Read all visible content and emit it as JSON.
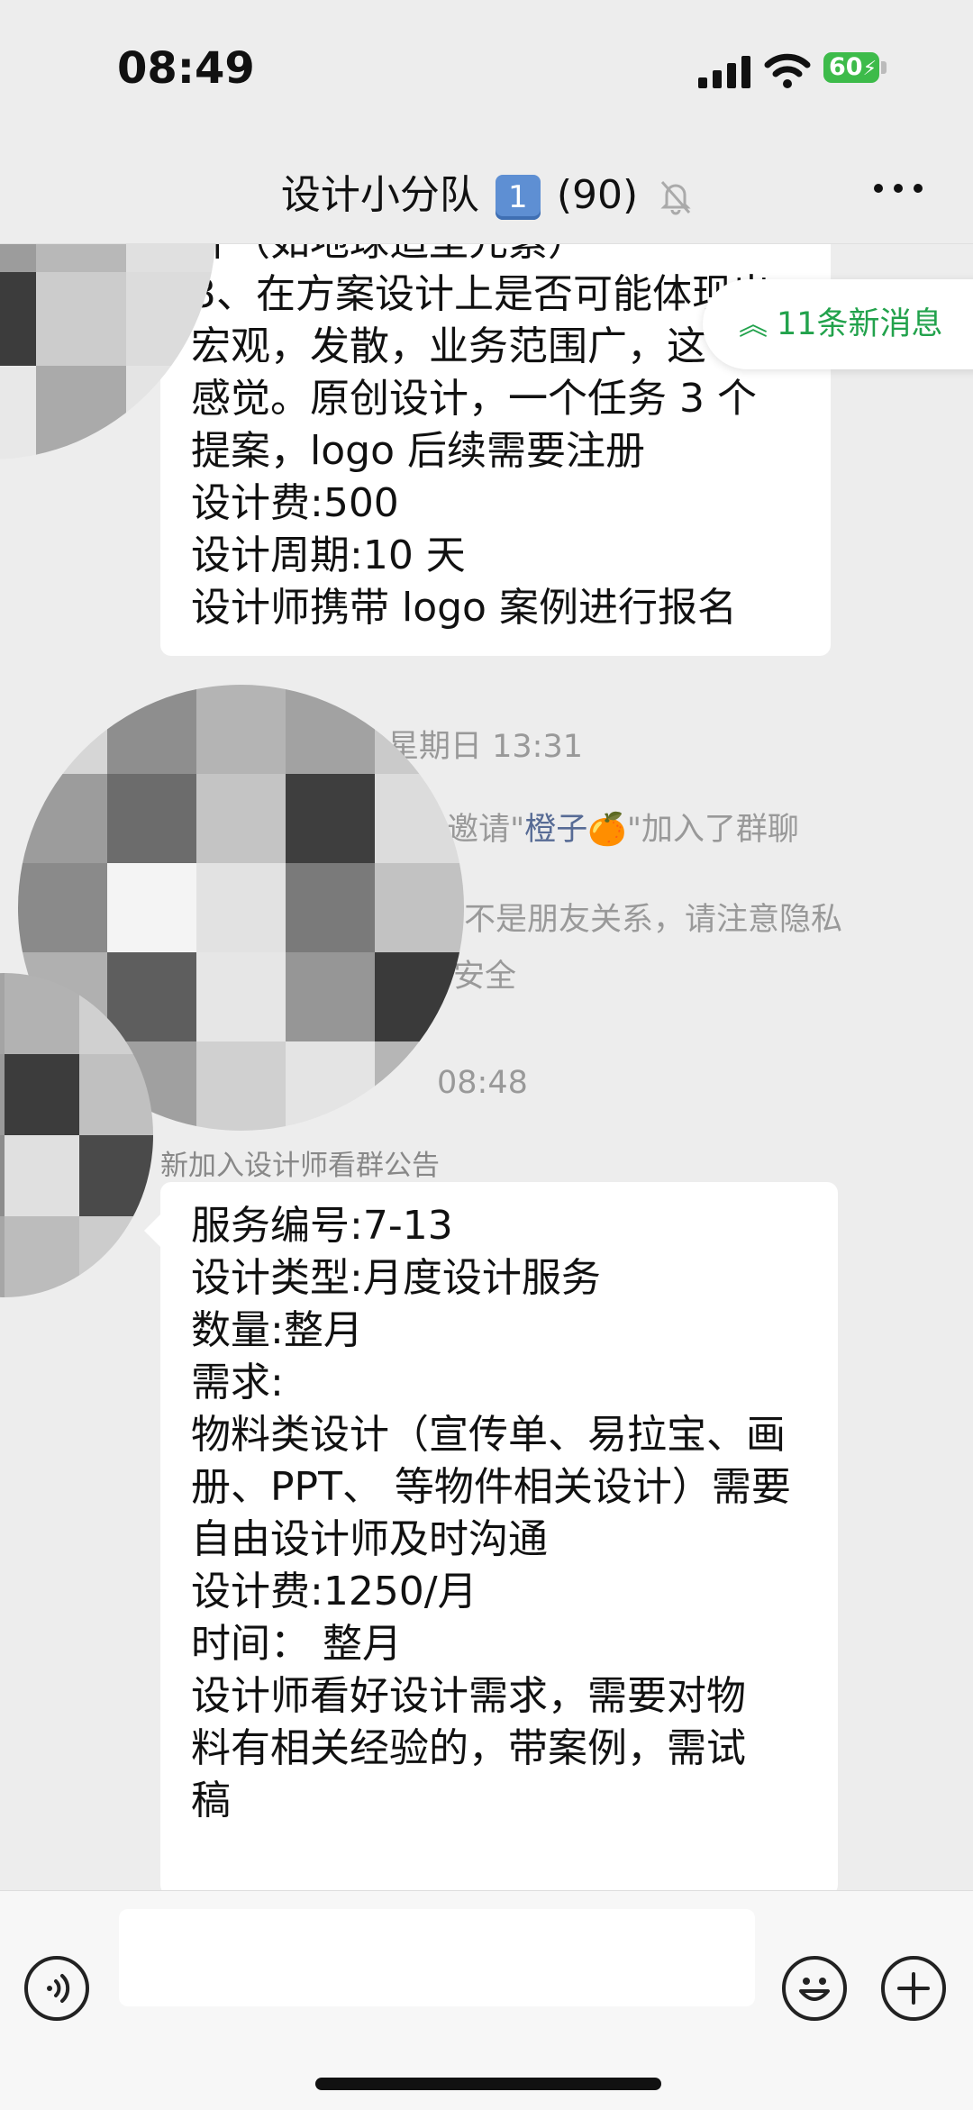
{
  "status_bar": {
    "time": "08:49",
    "battery": "60"
  },
  "header": {
    "title": "设计小分队",
    "badge": "1",
    "member_count": "(90)"
  },
  "new_messages_pill": {
    "label": "11条新消息"
  },
  "messages": {
    "first_bubble_text": "计（如地球造型元素）\n3、在方案设计上是否可能体现出\n宏观，发散，业务范围广，这\n感觉。原创设计，一个任务 3 个\n提案，logo 后续需要注册\n设计费:500\n设计周期:10 天\n设计师携带 logo 案例进行报名",
    "timestamp_1": "星期日 13:31",
    "system_invite": {
      "prefix": "\"邀请\"",
      "name": "橙子",
      "emoji": "🍊",
      "suffix": "\"加入了群聊"
    },
    "system_notice_line1": "都不是朋友关系，请注意隐私",
    "system_notice_line2": "安全",
    "timestamp_2": "08:48",
    "sender_name": "新加入设计师看群公告",
    "second_bubble_text": "服务编号:7-13\n设计类型:月度设计服务\n数量:整月\n需求:\n物料类设计（宣传单、易拉宝、画\n册、PPT、 等物件相关设计）需要\n自由设计师及时沟通\n设计费:1250/月\n时间： 整月\n设计师看好设计需求，需要对物\n料有相关经验的，带案例，需试\n稿"
  },
  "input_bar": {
    "placeholder": ""
  }
}
